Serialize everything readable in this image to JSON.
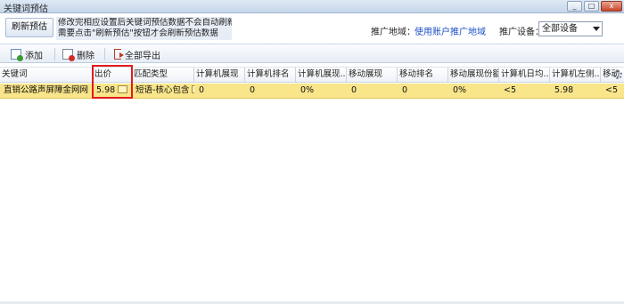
{
  "window": {
    "title": "关键词预估",
    "controls": [
      "_",
      "□",
      "x"
    ]
  },
  "topbar": {
    "refresh_label": "刷新预估",
    "notice_line1": "修改完相应设置后关键词预估数据不会自动刷新，",
    "notice_line2": "需要点击\"刷新预估\"按钮才会刷新预估数据",
    "region_label": "推广地域：",
    "region_link": "使用账户推广地域",
    "device_label": "推广设备：",
    "device_value": "全部设备"
  },
  "toolbar": {
    "add_label": "添加",
    "delete_label": "删除",
    "export_label": "全部导出"
  },
  "table": {
    "headers": [
      "关键词",
      "出价",
      "匹配类型",
      "计算机展现",
      "计算机排名",
      "计算机展现...",
      "移动展现",
      "移动排名",
      "移动展现份额",
      "计算机日均...",
      "计算机左侧...",
      "移动"
    ],
    "rows": [
      {
        "keyword": "直销公路声屏障金网网",
        "bid": "5.98",
        "match_type": "短语-核心包含",
        "pc_impressions": "0",
        "pc_rank": "0",
        "pc_share": "0%",
        "mobile_impressions": "0",
        "mobile_rank": "0",
        "mobile_share": "0%",
        "pc_daily": "<5",
        "pc_left": "5.98",
        "mobile_more": "<5"
      }
    ]
  },
  "colors": {
    "selected_row": "#f9e58a",
    "highlight_box": "#e21b1b",
    "link": "#1c50c6"
  }
}
